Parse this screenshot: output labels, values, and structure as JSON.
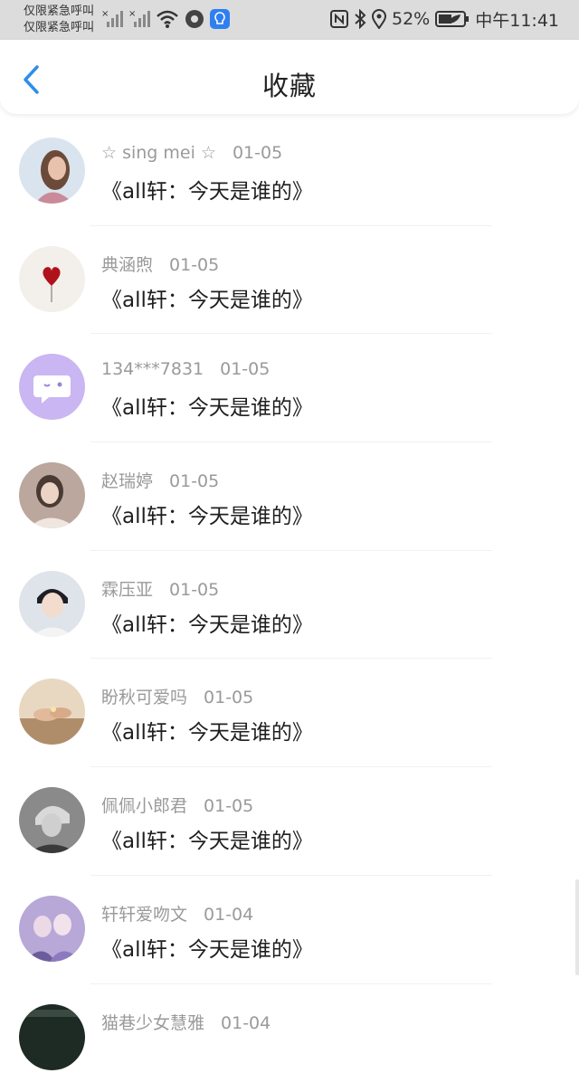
{
  "status_bar": {
    "carrier_line1": "仅限紧急呼叫",
    "carrier_line2": "仅限紧急呼叫",
    "battery": "52%",
    "time": "中午11:41"
  },
  "nav": {
    "title": "收藏"
  },
  "items": [
    {
      "name": "☆ sing mei ☆",
      "date": "01-05",
      "title": "《all轩：今天是谁的》",
      "avatar_color": "#c9a28a"
    },
    {
      "name": "典涵煦",
      "date": "01-05",
      "title": "《all轩：今天是谁的》",
      "avatar_color": "#f4f0ec"
    },
    {
      "name": "134***7831",
      "date": "01-05",
      "title": "《all轩：今天是谁的》",
      "avatar_color": "#c9b6f2"
    },
    {
      "name": "赵瑞婷",
      "date": "01-05",
      "title": "《all轩：今天是谁的》",
      "avatar_color": "#b89a8e"
    },
    {
      "name": "霖压亚",
      "date": "01-05",
      "title": "《all轩：今天是谁的》",
      "avatar_color": "#3a3a44"
    },
    {
      "name": "盼秋可爱吗",
      "date": "01-05",
      "title": "《all轩：今天是谁的》",
      "avatar_color": "#c9a888"
    },
    {
      "name": "佩佩小郎君",
      "date": "01-05",
      "title": "《all轩：今天是谁的》",
      "avatar_color": "#777777"
    },
    {
      "name": "轩轩爱吻文",
      "date": "01-04",
      "title": "《all轩：今天是谁的》",
      "avatar_color": "#9a85c0"
    },
    {
      "name": "猫巷少女慧雅",
      "date": "01-04",
      "title": "",
      "avatar_color": "#1e2a24"
    }
  ]
}
